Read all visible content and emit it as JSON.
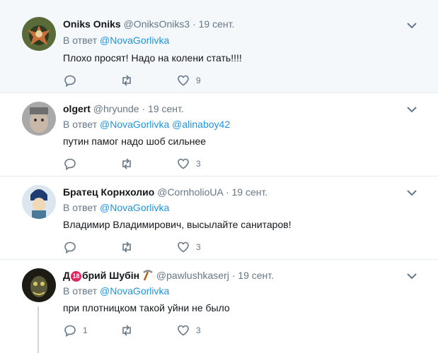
{
  "reply_prefix": "В ответ",
  "tweets": [
    {
      "name": "Oniks Oniks",
      "handle": "@OniksOniks3",
      "date": "19 сент.",
      "reply_to": [
        "@NovaGorlivka"
      ],
      "text": "Плохо просят! Надо на колени стать!!!!",
      "replies": "",
      "retweets": "",
      "likes": "9"
    },
    {
      "name": "olgert",
      "handle": "@hryunde",
      "date": "19 сент.",
      "reply_to": [
        "@NovaGorlivka",
        "@alinaboy42"
      ],
      "text": "путин памог надо шоб сильнее",
      "replies": "",
      "retweets": "",
      "likes": "3"
    },
    {
      "name": "Братец Корнхолио",
      "handle": "@CornholioUA",
      "date": "19 сент.",
      "reply_to": [
        "@NovaGorlivka"
      ],
      "text": "Владимир Владимирович, высылайте санитаров!",
      "replies": "",
      "retweets": "",
      "likes": "3"
    },
    {
      "name_pre": "Д",
      "name_badge": "18",
      "name_post": "брий Шубін",
      "handle": "@pawlushkaserj",
      "date": "19 сент.",
      "reply_to": [
        "@NovaGorlivka"
      ],
      "text": "при плотницком такой уйни не было",
      "replies": "1",
      "retweets": "",
      "likes": "3"
    }
  ],
  "separator": "·",
  "icons": {
    "reply": "reply-icon",
    "retweet": "retweet-icon",
    "like": "heart-icon",
    "menu": "chevron-down-icon",
    "emoji": "pickaxe-emoji"
  },
  "colors": {
    "link": "#1b95e0",
    "muted": "#657786",
    "highlight_bg": "#f5f8fa",
    "divider": "#e6ecf0",
    "badge": "#e0245e"
  }
}
